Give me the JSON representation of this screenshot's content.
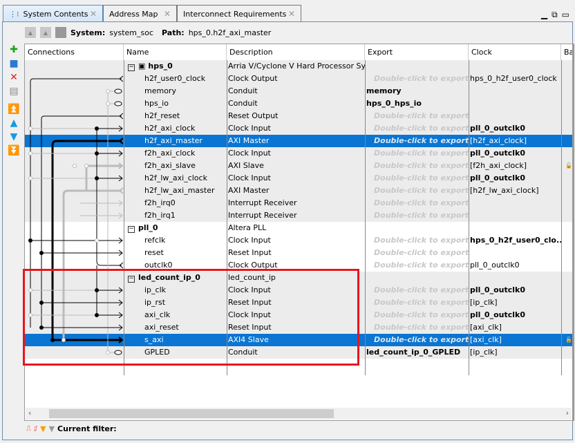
{
  "tabs": [
    {
      "label": "System Contents",
      "active": true
    },
    {
      "label": "Address Map"
    },
    {
      "label": "Interconnect Requirements"
    }
  ],
  "toolbar": {
    "system_label": "System:",
    "system_value": "system_soc",
    "path_label": "Path:",
    "path_value": "hps_0.h2f_axi_master"
  },
  "side_tools": [
    "add-icon",
    "add-component-icon",
    "remove-icon",
    "edit-icon",
    "move-top-icon",
    "move-up-icon",
    "move-down-icon",
    "move-bottom-icon"
  ],
  "columns": [
    "Connections",
    "Name",
    "Description",
    "Export",
    "Clock",
    "Ba"
  ],
  "export_placeholder": "Double-click to export",
  "rows": [
    {
      "name": "hps_0",
      "desc": "Arria V/Cyclone V Hard Processor System",
      "group": true,
      "shade": true
    },
    {
      "name": "h2f_user0_clock",
      "desc": "Clock Output",
      "export": "",
      "clock": "hps_0_h2f_user0_clock",
      "shade": true
    },
    {
      "name": "memory",
      "desc": "Conduit",
      "export": "memory",
      "exportBold": true,
      "shade": true
    },
    {
      "name": "hps_io",
      "desc": "Conduit",
      "export": "hps_0_hps_io",
      "exportBold": true,
      "shade": true
    },
    {
      "name": "h2f_reset",
      "desc": "Reset Output",
      "export": "",
      "shade": true
    },
    {
      "name": "h2f_axi_clock",
      "desc": "Clock Input",
      "export": "",
      "clock": "pll_0_outclk0",
      "clockBold": true,
      "shade": true
    },
    {
      "name": "h2f_axi_master",
      "desc": "AXI Master",
      "export": "",
      "clock": "[h2f_axi_clock]",
      "selected": true
    },
    {
      "name": "f2h_axi_clock",
      "desc": "Clock Input",
      "export": "",
      "clock": "pll_0_outclk0",
      "clockBold": true,
      "shade": true
    },
    {
      "name": "f2h_axi_slave",
      "desc": "AXI Slave",
      "export": "",
      "clock": "[f2h_axi_clock]",
      "lock": true,
      "shade": true
    },
    {
      "name": "h2f_lw_axi_clock",
      "desc": "Clock Input",
      "export": "",
      "clock": "pll_0_outclk0",
      "clockBold": true,
      "shade": true
    },
    {
      "name": "h2f_lw_axi_master",
      "desc": "AXI Master",
      "export": "",
      "clock": "[h2f_lw_axi_clock]",
      "shade": true
    },
    {
      "name": "f2h_irq0",
      "desc": "Interrupt Receiver",
      "export": "",
      "shade": true
    },
    {
      "name": "f2h_irq1",
      "desc": "Interrupt Receiver",
      "export": "",
      "shade": true
    },
    {
      "name": "pll_0",
      "desc": "Altera PLL",
      "group": true
    },
    {
      "name": "refclk",
      "desc": "Clock Input",
      "export": "",
      "clock": "hps_0_h2f_user0_clo...",
      "clockBold": true
    },
    {
      "name": "reset",
      "desc": "Reset Input",
      "export": ""
    },
    {
      "name": "outclk0",
      "desc": "Clock Output",
      "export": "",
      "clock": "pll_0_outclk0"
    },
    {
      "name": "led_count_ip_0",
      "desc": "led_count_ip",
      "group": true,
      "shade": true
    },
    {
      "name": "ip_clk",
      "desc": "Clock Input",
      "export": "",
      "clock": "pll_0_outclk0",
      "clockBold": true,
      "shade": true
    },
    {
      "name": "ip_rst",
      "desc": "Reset Input",
      "export": "",
      "clock": "[ip_clk]",
      "shade": true
    },
    {
      "name": "axi_clk",
      "desc": "Clock Input",
      "export": "",
      "clock": "pll_0_outclk0",
      "clockBold": true,
      "shade": true
    },
    {
      "name": "axi_reset",
      "desc": "Reset Input",
      "export": "",
      "clock": "[axi_clk]",
      "shade": true
    },
    {
      "name": "s_axi",
      "desc": "AXI4 Slave",
      "export": "",
      "clock": "[axi_clk]",
      "selected": true,
      "lock": true
    },
    {
      "name": "GPLED",
      "desc": "Conduit",
      "export": "led_count_ip_0_GPLED",
      "exportBold": true,
      "clock": "[ip_clk]",
      "shade": true
    }
  ],
  "filter": {
    "label": "Current filter:"
  },
  "colors": {
    "selection": "#0a75d2",
    "highlight_box": "#e8141e"
  }
}
